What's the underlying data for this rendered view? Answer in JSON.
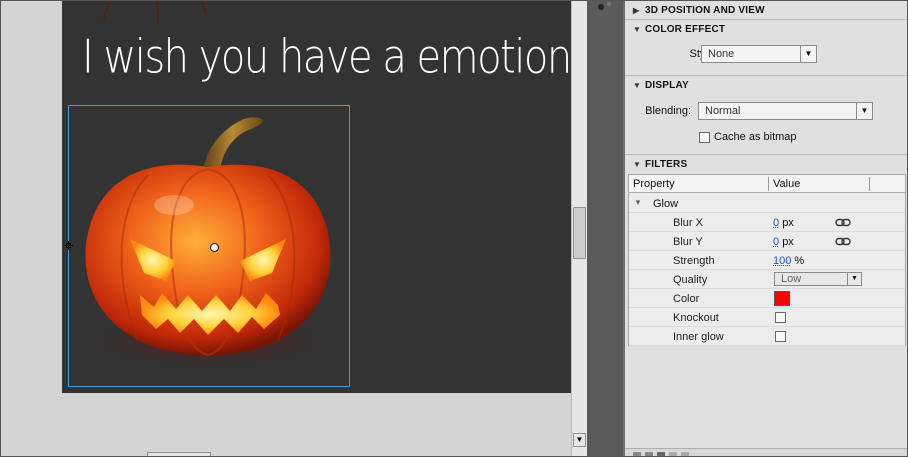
{
  "stage": {
    "canvas_text": "I wish you have a emotion halloween",
    "canvas_color": "#333333",
    "selection_color": "#3aa0e0"
  },
  "panel": {
    "sections": {
      "position_3d": "3D POSITION AND VIEW",
      "color_effect": "COLOR EFFECT",
      "display": "DISPLAY",
      "filters": "FILTERS"
    },
    "color_effect": {
      "style_label": "Style:",
      "style_value": "None"
    },
    "display": {
      "blending_label": "Blending:",
      "blending_value": "Normal",
      "cache_label": "Cache as bitmap",
      "cache_checked": false
    },
    "filters": {
      "col_property": "Property",
      "col_value": "Value",
      "group_name": "Glow",
      "blur_x_label": "Blur X",
      "blur_x_value": "0",
      "blur_x_unit": "px",
      "blur_y_label": "Blur Y",
      "blur_y_value": "0",
      "blur_y_unit": "px",
      "strength_label": "Strength",
      "strength_value": "100",
      "strength_unit": "%",
      "quality_label": "Quality",
      "quality_value": "Low",
      "color_label": "Color",
      "color_value": "#ff0000",
      "knockout_label": "Knockout",
      "knockout_checked": false,
      "inner_glow_label": "Inner glow",
      "inner_glow_checked": false
    }
  },
  "icons": {
    "collapse": "triangle-down-icon",
    "expand": "triangle-right-icon",
    "link": "chain-link-icon",
    "dropdown": "chevron-down-icon"
  }
}
